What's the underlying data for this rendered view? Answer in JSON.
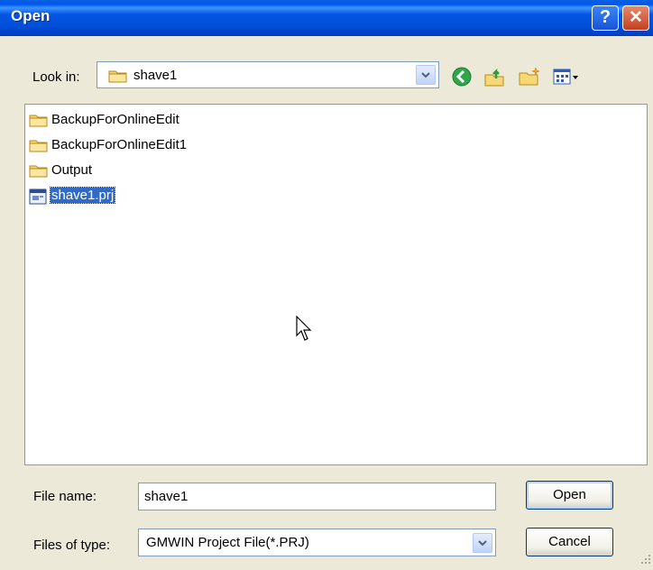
{
  "window": {
    "title": "Open",
    "help_label": "?",
    "close_label": "✕"
  },
  "look_in": {
    "label": "Look in:",
    "value": "shave1"
  },
  "toolbar": {
    "icons": [
      "back-icon",
      "up-folder-icon",
      "new-folder-icon",
      "view-menu-icon"
    ]
  },
  "files": [
    {
      "name": "BackupForOnlineEdit",
      "type": "folder",
      "selected": false
    },
    {
      "name": "BackupForOnlineEdit1",
      "type": "folder",
      "selected": false
    },
    {
      "name": "Output",
      "type": "folder",
      "selected": false
    },
    {
      "name": "shave1.prj",
      "type": "file",
      "selected": true
    }
  ],
  "file_name": {
    "label": "File name:",
    "value": "shave1"
  },
  "file_type": {
    "label": "Files of type:",
    "value": "GMWIN Project File(*.PRJ)"
  },
  "buttons": {
    "open": "Open",
    "cancel": "Cancel"
  },
  "colors": {
    "title_bar": "#0054E3",
    "selection": "#316AC5",
    "dialog_bg": "#ECE9D8"
  }
}
